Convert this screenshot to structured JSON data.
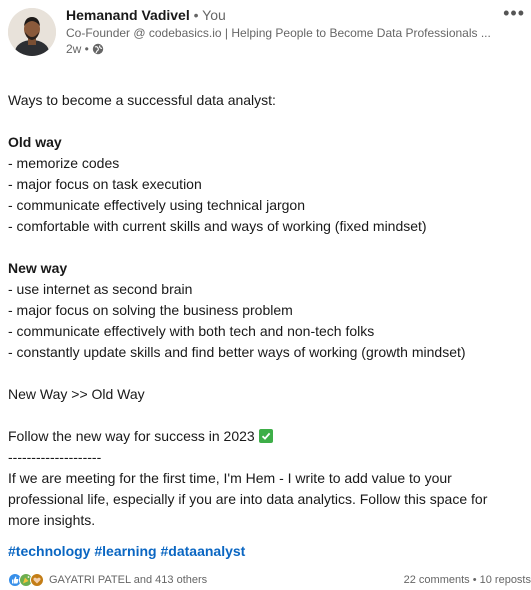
{
  "post": {
    "author": {
      "name": "Hemanand Vadivel",
      "relation": " • You",
      "headline": "Co-Founder @ codebasics.io | Helping People to Become Data Professionals ...",
      "time": "2w •"
    },
    "more_label": "•••",
    "body": {
      "intro": "Ways to become a successful data analyst:",
      "old_heading": "Old way",
      "old_items": [
        "- memorize codes",
        "- major focus on task execution",
        "- communicate effectively using technical jargon",
        "- comfortable with current skills and ways of working (fixed mindset)"
      ],
      "new_heading": "New way",
      "new_items": [
        "- use internet as second brain",
        "- major focus on solving the business problem",
        "- communicate effectively with both tech and non-tech folks",
        "- constantly update skills and find better ways of working (growth mindset)"
      ],
      "comparison": "New Way >> Old Way",
      "cta": "Follow the new way for success in 2023",
      "divider": "--------------------",
      "closing": "If we are meeting for the first time, I'm Hem - I write to add value to your professional life, especially if you are into data analytics. Follow this space for more insights."
    },
    "hashtags": [
      "#technology",
      "#learning",
      "#dataanalyst"
    ],
    "social": {
      "reactors": "GAYATRI PATEL and 413 others",
      "comments": "22 comments",
      "separator": " • ",
      "reposts": "10 reposts"
    },
    "colors": {
      "link": "#0a66c2",
      "check": "#3eae48"
    }
  }
}
